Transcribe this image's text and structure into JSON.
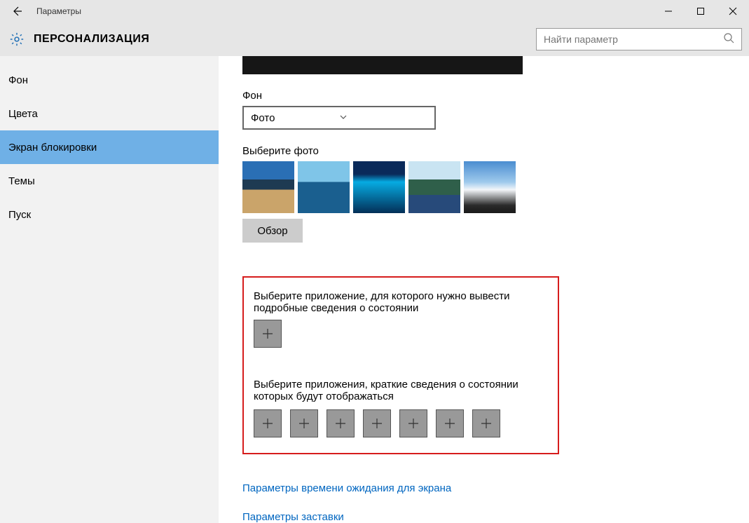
{
  "window": {
    "title": "Параметры"
  },
  "header": {
    "section": "ПЕРСОНАЛИЗАЦИЯ",
    "search_placeholder": "Найти параметр"
  },
  "sidebar": {
    "items": [
      {
        "label": "Фон",
        "active": false
      },
      {
        "label": "Цвета",
        "active": false
      },
      {
        "label": "Экран блокировки",
        "active": true
      },
      {
        "label": "Темы",
        "active": false
      },
      {
        "label": "Пуск",
        "active": false
      }
    ]
  },
  "content": {
    "background_label": "Фон",
    "background_value": "Фото",
    "choose_photo_label": "Выберите фото",
    "browse_label": "Обзор",
    "detailed_app_label": "Выберите приложение, для которого нужно вывести подробные сведения о состоянии",
    "quick_apps_label": "Выберите приложения, краткие сведения о состоянии которых будут отображаться",
    "link_timeout": "Параметры времени ожидания для экрана",
    "link_screensaver": "Параметры заставки"
  },
  "colors": {
    "accent": "#6fb0e6",
    "link": "#0066c0",
    "highlight_border": "#d61c1c"
  }
}
